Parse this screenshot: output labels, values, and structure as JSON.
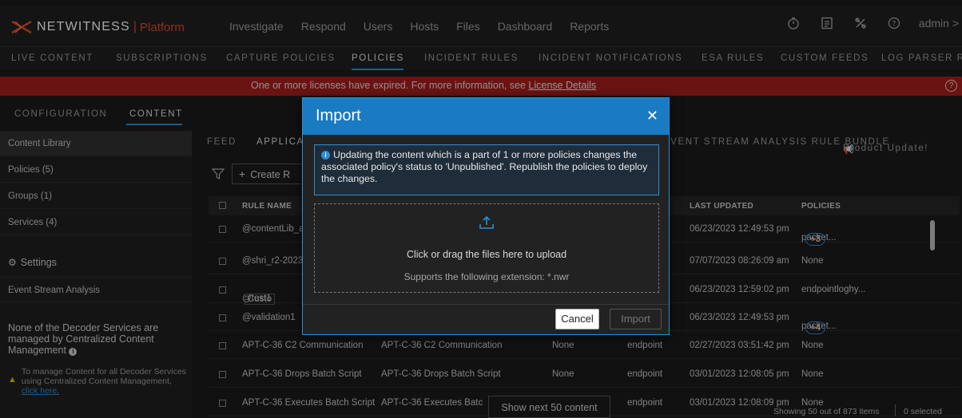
{
  "brand": {
    "name": "NETWITNESS",
    "sep": "|",
    "product": "Platform"
  },
  "nav": [
    "Investigate",
    "Respond",
    "Users",
    "Hosts",
    "Files",
    "Dashboard",
    "Reports"
  ],
  "user": {
    "label": "admin >"
  },
  "subnav": [
    "LIVE CONTENT",
    "SUBSCRIPTIONS",
    "CAPTURE POLICIES",
    "POLICIES",
    "INCIDENT RULES",
    "INCIDENT NOTIFICATIONS",
    "ESA RULES",
    "CUSTOM FEEDS",
    "LOG PARSER R"
  ],
  "banner": {
    "text": "One or more licenses have expired. For more information, see ",
    "link": "License Details"
  },
  "config_tabs": [
    "CONFIGURATION",
    "CONTENT"
  ],
  "sidebar": {
    "items": [
      "Content Library",
      "Policies (5)",
      "Groups (1)",
      "Services (4)"
    ],
    "settings": "Settings",
    "esa": "Event Stream Analysis",
    "note": "None of the Decoder Services are managed by Centralized Content Management",
    "warn_text": "To manage Content for all Decoder Services using Centralized Content Management, ",
    "warn_link": "click here."
  },
  "main_tabs": {
    "feed": "FEED",
    "applica": "APPLICA",
    "esa_bundle": "EVENT STREAM ANALYSIS RULE BUNDLE",
    "product_update": "Product Update!"
  },
  "toolbar": {
    "create": "Create R"
  },
  "table": {
    "headers": {
      "rule_name": "RULE NAME",
      "last_updated": "LAST UPDATED",
      "policies": "POLICIES"
    },
    "rows": [
      {
        "name": "@contentLib_ap",
        "desc": "",
        "c1": "",
        "c2": "",
        "updated": "06/23/2023 12:49:53 pm",
        "policies": "packet...",
        "badge": "+3",
        "tag": ""
      },
      {
        "name": "@shri_r2-2023",
        "desc": "",
        "c1": "",
        "c2": "",
        "updated": "07/07/2023 08:26:09 am",
        "policies": "None",
        "badge": "",
        "tag": ""
      },
      {
        "name": "@test1",
        "desc": "",
        "c1": "",
        "c2": "",
        "updated": "06/23/2023 12:59:02 pm",
        "policies": "endpointloghy...",
        "badge": "",
        "tag": "Custo"
      },
      {
        "name": "@validation1",
        "desc": "",
        "c1": "",
        "c2": "",
        "updated": "06/23/2023 12:49:53 pm",
        "policies": "packet...",
        "badge": "+4",
        "tag": ""
      },
      {
        "name": "APT-C-36 C2 Communication",
        "desc": "APT-C-36 C2 Communication",
        "c1": "None",
        "c2": "endpoint",
        "updated": "02/27/2023 03:51:42 pm",
        "policies": "None",
        "badge": "",
        "tag": ""
      },
      {
        "name": "APT-C-36 Drops Batch Script",
        "desc": "APT-C-36 Drops Batch Script",
        "c1": "None",
        "c2": "endpoint",
        "updated": "03/01/2023 12:08:05 pm",
        "policies": "None",
        "badge": "",
        "tag": ""
      },
      {
        "name": "APT-C-36 Executes Batch Script",
        "desc": "APT-C-36 Executes Batc",
        "c1": "",
        "c2": "endpoint",
        "updated": "03/01/2023 12:08:09 pm",
        "policies": "None",
        "badge": "",
        "tag": ""
      }
    ]
  },
  "pager": {
    "show_next": "Show next 50 content",
    "status": "Showing 50 out of 873 items",
    "selected": "0 selected"
  },
  "modal": {
    "title": "Import",
    "info": "Updating the content which is a part of 1 or more policies changes the associated policy's status to 'Unpublished'. Republish the policies to deploy the changes.",
    "drop_text": "Click or drag the files here to upload",
    "drop_sub": "Supports the following extension: *.nwr",
    "cancel": "Cancel",
    "import": "Import"
  },
  "colors": {
    "accent": "#2b8fd4",
    "banner": "#a11f1d",
    "brand": "#d84a2f"
  },
  "icons": [
    "logo-icon",
    "timer-icon",
    "report-icon",
    "tools-icon",
    "help-icon",
    "gear-icon",
    "warning-icon",
    "filter-icon",
    "plus-icon",
    "info-icon",
    "upload-icon",
    "close-icon",
    "megaphone-icon"
  ]
}
